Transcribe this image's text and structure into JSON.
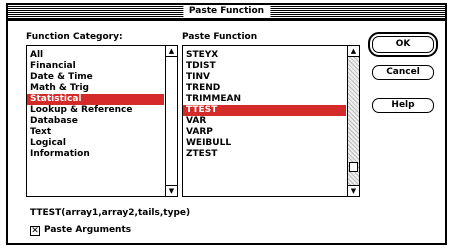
{
  "window": {
    "title": "Paste Function"
  },
  "category": {
    "label": "Function Category:",
    "items": [
      "All",
      "Financial",
      "Date & Time",
      "Math & Trig",
      "Statistical",
      "Lookup & Reference",
      "Database",
      "Text",
      "Logical",
      "Information"
    ],
    "selected_index": 4
  },
  "function": {
    "label": "Paste Function",
    "items": [
      "STEYX",
      "TDIST",
      "TINV",
      "TREND",
      "TRIMMEAN",
      "TTEST",
      "VAR",
      "VARP",
      "WEIBULL",
      "ZTEST"
    ],
    "selected_index": 5
  },
  "buttons": {
    "ok": "OK",
    "cancel": "Cancel",
    "help": "Help"
  },
  "syntax": "TTEST(array1,array2,tails,type)",
  "paste_arguments": {
    "label": "Paste Arguments",
    "checked": true,
    "check_glyph": "✕"
  },
  "icons": {
    "scroll_up": "▲",
    "scroll_down": "▼"
  },
  "colors": {
    "selection": "#d42a2a"
  }
}
